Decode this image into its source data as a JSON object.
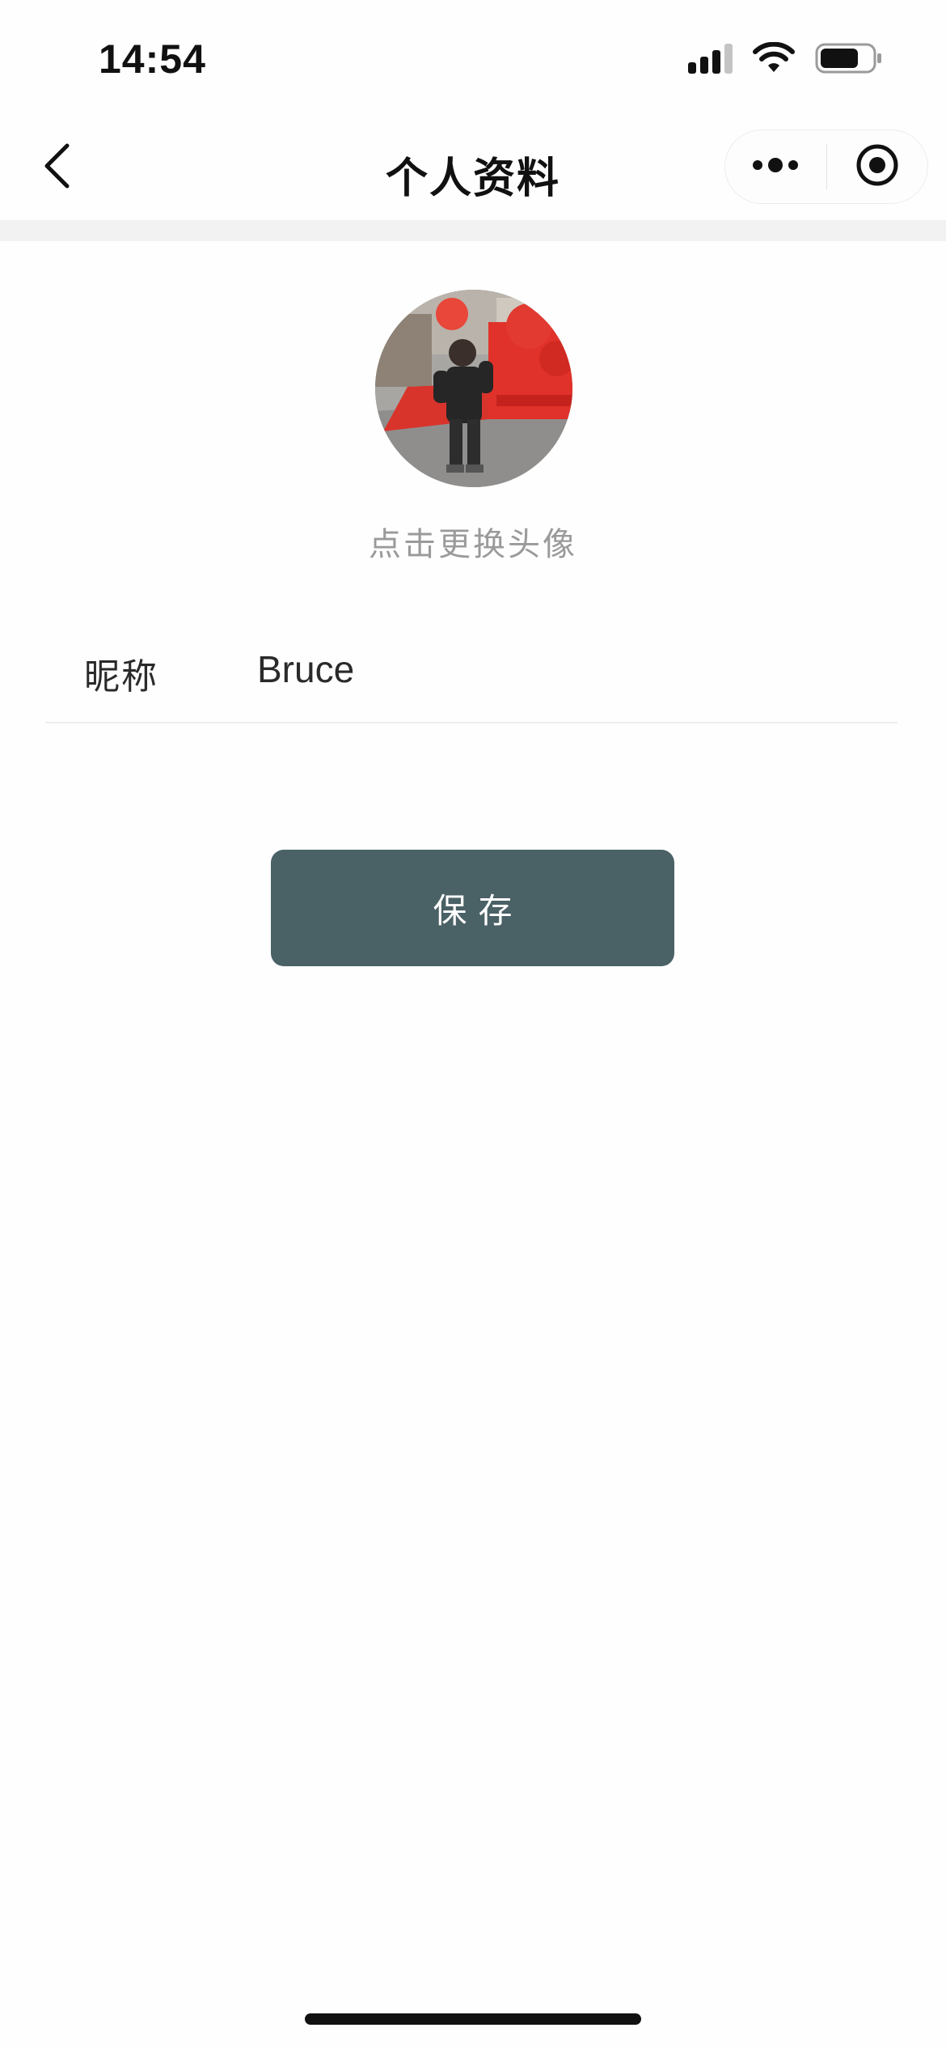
{
  "status_bar": {
    "time": "14:54",
    "icons": [
      "cellular-signal-icon",
      "wifi-icon",
      "battery-icon"
    ],
    "battery_level": 0.75
  },
  "nav": {
    "title": "个人资料",
    "back_icon": "chevron-left-icon",
    "capsule_icons": [
      "more-dots-icon",
      "close-circle-icon"
    ]
  },
  "profile": {
    "avatar_hint": "点击更换头像",
    "nickname_label": "昵称",
    "nickname_value": "Bruce"
  },
  "actions": {
    "save_label": "保存"
  },
  "colors": {
    "save_button_bg": "#4a6166",
    "hint_text": "#9a9a9a",
    "separator": "#f2f2f2"
  }
}
